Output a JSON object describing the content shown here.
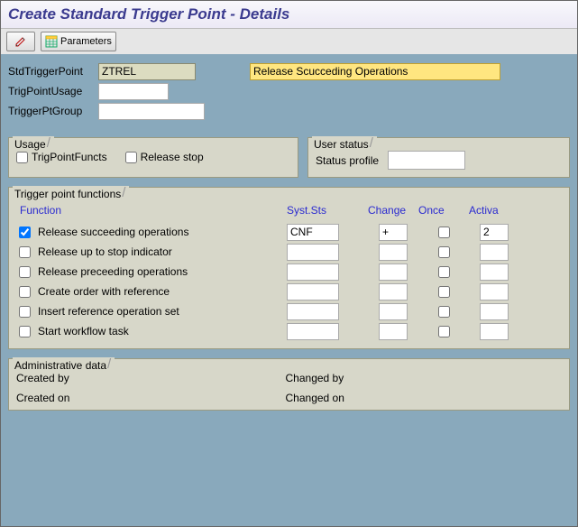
{
  "window": {
    "title": "Create Standard Trigger Point - Details"
  },
  "toolbar": {
    "parameters_label": "Parameters"
  },
  "header": {
    "std_label": "StdTriggerPoint",
    "std_value": "ZTREL",
    "desc_value": "Release Scucceding Operations",
    "usage_label": "TrigPointUsage",
    "usage_value": "",
    "group_label": "TriggerPtGroup",
    "group_value": ""
  },
  "usage_box": {
    "title": "Usage",
    "functs_label": "TrigPointFuncts",
    "releasestop_label": "Release stop"
  },
  "userstatus_box": {
    "title": "User status",
    "profile_label": "Status profile",
    "profile_value": ""
  },
  "functions_box": {
    "title": "Trigger point functions",
    "col_function": "Function",
    "col_syssts": "Syst.Sts",
    "col_change": "Change",
    "col_once": "Once",
    "col_activa": "Activa",
    "rows": [
      {
        "checked": true,
        "name": "Release succeeding operations",
        "sys": "CNF",
        "change": "+",
        "activa": "2"
      },
      {
        "checked": false,
        "name": "Release up to stop indicator",
        "sys": "",
        "change": "",
        "activa": ""
      },
      {
        "checked": false,
        "name": "Release preceeding operations",
        "sys": "",
        "change": "",
        "activa": ""
      },
      {
        "checked": false,
        "name": "Create order with reference",
        "sys": "",
        "change": "",
        "activa": ""
      },
      {
        "checked": false,
        "name": "Insert reference operation set",
        "sys": "",
        "change": "",
        "activa": ""
      },
      {
        "checked": false,
        "name": "Start workflow task",
        "sys": "",
        "change": "",
        "activa": ""
      }
    ]
  },
  "admin_box": {
    "title": "Administrative data",
    "created_by_label": "Created by",
    "created_on_label": "Created on",
    "changed_by_label": "Changed by",
    "changed_on_label": "Changed on"
  }
}
